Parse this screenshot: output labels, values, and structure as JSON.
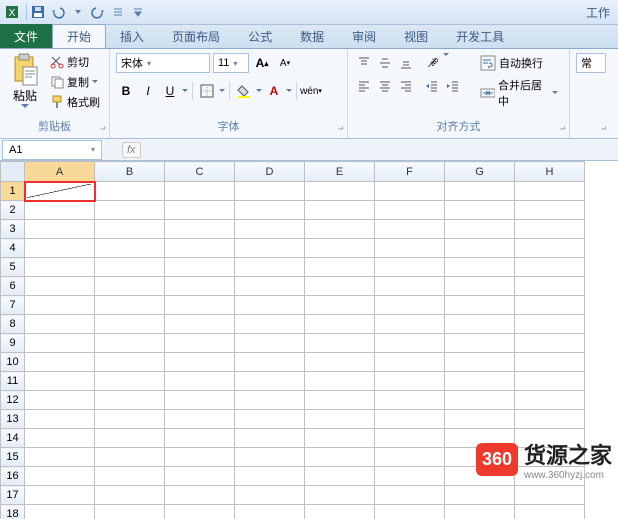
{
  "title_bar": {
    "doc_hint": "工作"
  },
  "qat": {
    "save": "保存",
    "undo": "撤销",
    "redo": "重做"
  },
  "tabs": {
    "file": "文件",
    "home": "开始",
    "insert": "插入",
    "layout": "页面布局",
    "formulas": "公式",
    "data": "数据",
    "review": "审阅",
    "view": "视图",
    "dev": "开发工具"
  },
  "ribbon": {
    "clipboard": {
      "paste": "粘贴",
      "cut": "剪切",
      "copy": "复制",
      "format_painter": "格式刷",
      "group": "剪贴板"
    },
    "font": {
      "name": "宋体",
      "size": "11",
      "group": "字体"
    },
    "align": {
      "wrap": "自动换行",
      "merge": "合并后居中",
      "group": "对齐方式"
    },
    "number": {
      "general": "常"
    }
  },
  "formula_bar": {
    "name_box": "A1"
  },
  "sheet": {
    "cols": [
      "A",
      "B",
      "C",
      "D",
      "E",
      "F",
      "G",
      "H"
    ],
    "rows": [
      "1",
      "2",
      "3",
      "4",
      "5",
      "6",
      "7",
      "8",
      "9",
      "10",
      "11",
      "12",
      "13",
      "14",
      "15",
      "16",
      "17",
      "18"
    ],
    "active_col": "A",
    "active_row": "1",
    "selected": "A1"
  },
  "watermark": {
    "badge": "360",
    "title": "货源之家",
    "url": "www.360hyzj.com"
  }
}
